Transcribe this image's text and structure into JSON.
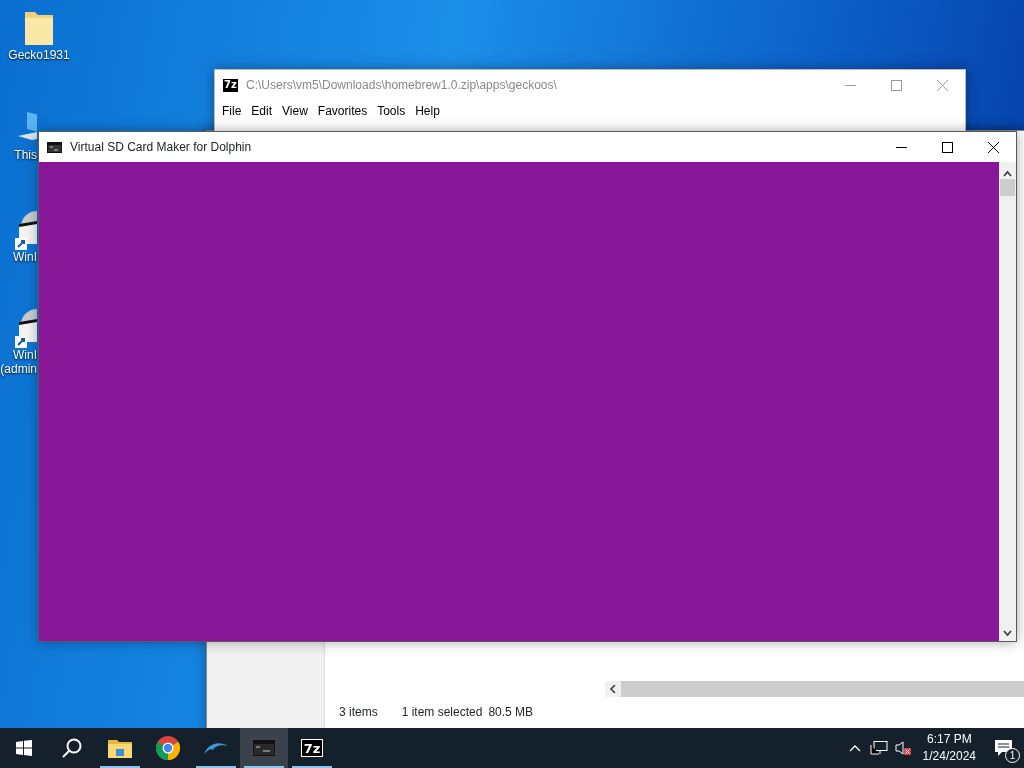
{
  "desktop_icons": [
    {
      "label": "Gecko1931",
      "kind": "folder"
    },
    {
      "label": "This",
      "kind": "computer"
    },
    {
      "label": "WinI",
      "kind": "disc"
    },
    {
      "label": "WinI (admin",
      "kind": "disc"
    }
  ],
  "explorer_window": {
    "app_badge": "7z",
    "title": "C:\\Users\\vm5\\Downloads\\homebrew1.0.zip\\apps\\geckoos\\",
    "menu": [
      "File",
      "Edit",
      "View",
      "Favorites",
      "Tools",
      "Help"
    ],
    "status_bar": [
      "3 items",
      "1 item selected",
      "80.5 MB"
    ]
  },
  "console_window": {
    "title": "Virtual SD Card Maker for Dolphin"
  },
  "taskbar": {
    "apps": [
      {
        "kind": "folder",
        "running": true,
        "selected": false
      },
      {
        "kind": "browser",
        "running": false,
        "selected": false
      },
      {
        "kind": "dolphin",
        "running": true,
        "selected": false
      },
      {
        "kind": "console",
        "running": true,
        "selected": true
      },
      {
        "kind": "archiver",
        "label": "7z",
        "running": true,
        "selected": false
      }
    ],
    "time": "6:17 PM",
    "date": "1/24/2024",
    "notification_count": "1"
  }
}
